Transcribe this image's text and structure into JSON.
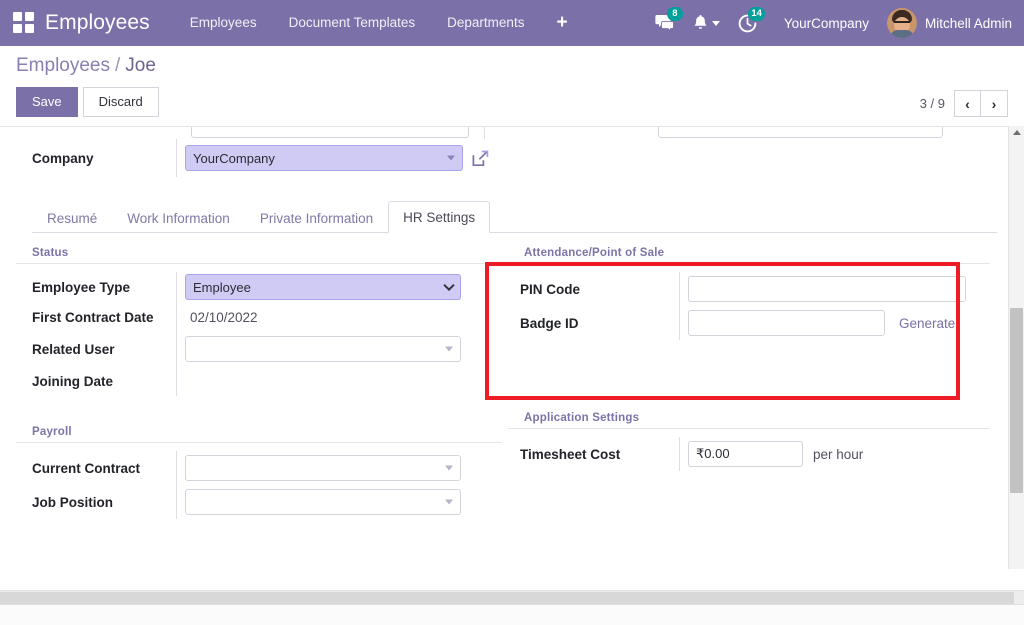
{
  "navbar": {
    "apps_icon": "apps-grid-icon",
    "brand": "Employees",
    "menu_items": [
      {
        "label": "Employees"
      },
      {
        "label": "Document Templates"
      },
      {
        "label": "Departments"
      }
    ],
    "plus_label": "+",
    "messages": {
      "icon": "chat-icon",
      "badge": "8"
    },
    "notifications": {
      "icon": "bell-icon",
      "caret": "chevron-down-icon"
    },
    "activities": {
      "icon": "clock-icon",
      "badge": "14"
    },
    "company": "YourCompany",
    "user": "Mitchell Admin",
    "accent_color": "#7b70a8",
    "badge_color": "#00a09d"
  },
  "control_panel": {
    "breadcrumb_root": "Employees",
    "breadcrumb_sep": "/",
    "breadcrumb_current": "Joe",
    "save_label": "Save",
    "discard_label": "Discard",
    "pager_count": "3 / 9",
    "pager_prev": "‹",
    "pager_next": "›"
  },
  "form": {
    "company_field": {
      "label": "Company",
      "value": "YourCompany",
      "external_link_icon": "external-link-icon"
    }
  },
  "tabs": [
    {
      "label": "Resumé",
      "active": false
    },
    {
      "label": "Work Information",
      "active": false
    },
    {
      "label": "Private Information",
      "active": false
    },
    {
      "label": "HR Settings",
      "active": true
    }
  ],
  "status_section": {
    "title": "Status",
    "fields": {
      "employee_type": {
        "label": "Employee Type",
        "value": "Employee"
      },
      "first_contract_date": {
        "label": "First Contract Date",
        "value": "02/10/2022"
      },
      "related_user": {
        "label": "Related User",
        "value": ""
      },
      "joining_date": {
        "label": "Joining Date",
        "value": ""
      }
    }
  },
  "payroll_section": {
    "title": "Payroll",
    "fields": {
      "current_contract": {
        "label": "Current Contract",
        "value": ""
      },
      "job_position": {
        "label": "Job Position",
        "value": ""
      }
    }
  },
  "attendance_section": {
    "title": "Attendance/Point of Sale",
    "highlighted": true,
    "highlight_color": "#ee1c25",
    "fields": {
      "pin_code": {
        "label": "PIN Code",
        "value": ""
      },
      "badge_id": {
        "label": "Badge ID",
        "value": "",
        "action_label": "Generate"
      }
    }
  },
  "application_settings_section": {
    "title": "Application Settings",
    "fields": {
      "timesheet_cost": {
        "label": "Timesheet Cost",
        "value": "₹0.00",
        "suffix": "per hour"
      }
    }
  }
}
